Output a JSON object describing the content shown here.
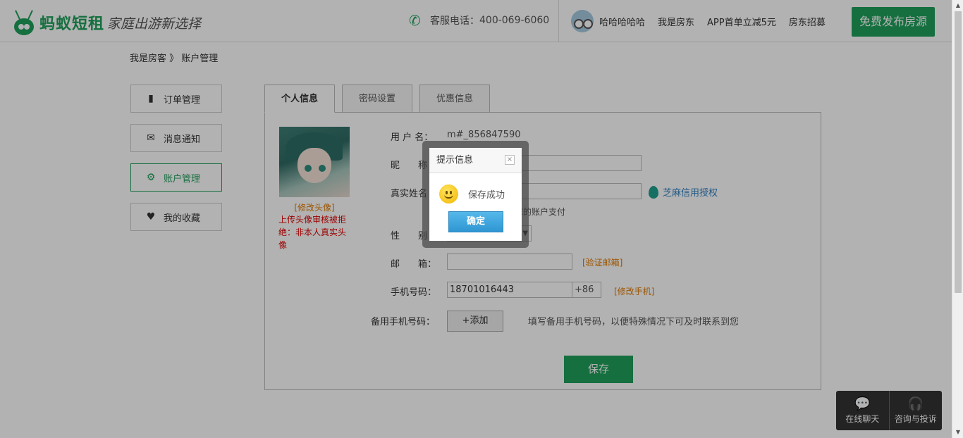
{
  "header": {
    "brand": "蚂蚁短租",
    "slogan": "家庭出游新选择",
    "hotline_label": "客服电话：",
    "hotline_number": "400-069-6060",
    "username": "哈哈哈哈哈",
    "host_link": "我是房东",
    "app_promo": "APP首单立减5元",
    "recruit_link": "房东招募",
    "publish_button": "免费发布房源"
  },
  "breadcrumb": {
    "root": "我是房客",
    "separator": " 》",
    "current": "账户管理"
  },
  "sidebar": {
    "items": [
      {
        "label": "订单管理",
        "icon": "document-icon"
      },
      {
        "label": "消息通知",
        "icon": "envelope-icon"
      },
      {
        "label": "账户管理",
        "icon": "gear-icon",
        "active": true
      },
      {
        "label": "我的收藏",
        "icon": "heart-icon"
      }
    ]
  },
  "tabs": [
    {
      "label": "个人信息",
      "active": true
    },
    {
      "label": "密码设置"
    },
    {
      "label": "优惠信息"
    }
  ],
  "profile": {
    "change_photo": "[修改头像]",
    "photo_warning": "上传头像审核被拒绝：非本人真实头像",
    "username_label": "用 户 名：",
    "username_value": "m#_856847590",
    "nickname_label": "昵　　称",
    "nickname_value": "",
    "realname_label": "真实姓名",
    "realname_value": "",
    "zhima_link": "芝麻信用授权",
    "realname_hint": "，否则影响我们向您的账户支付",
    "gender_label": "性　　别",
    "gender_value": "",
    "email_label": "邮　　箱：",
    "email_value": "",
    "verify_email": "[验证邮箱]",
    "phone_label": "手机号码：",
    "phone_value": "18701016443",
    "phone_prefix": "+86",
    "change_phone": "[修改手机]",
    "backup_phone_label": "备用手机号码：",
    "add_button": "+添加",
    "backup_phone_hint": "填写备用手机号码，以便特殊情况下可及时联系到您",
    "save_button": "保存"
  },
  "float_contact": {
    "chat": "在线聊天",
    "complaint": "咨询与投诉"
  },
  "dialog": {
    "title": "提示信息",
    "close": "×",
    "message": "保存成功",
    "ok_button": "确定"
  },
  "colors": {
    "brand_green": "#1f9f5b",
    "link_orange": "#e07a00",
    "warning_red": "#e00000",
    "dialog_blue": "#2f96d3"
  }
}
